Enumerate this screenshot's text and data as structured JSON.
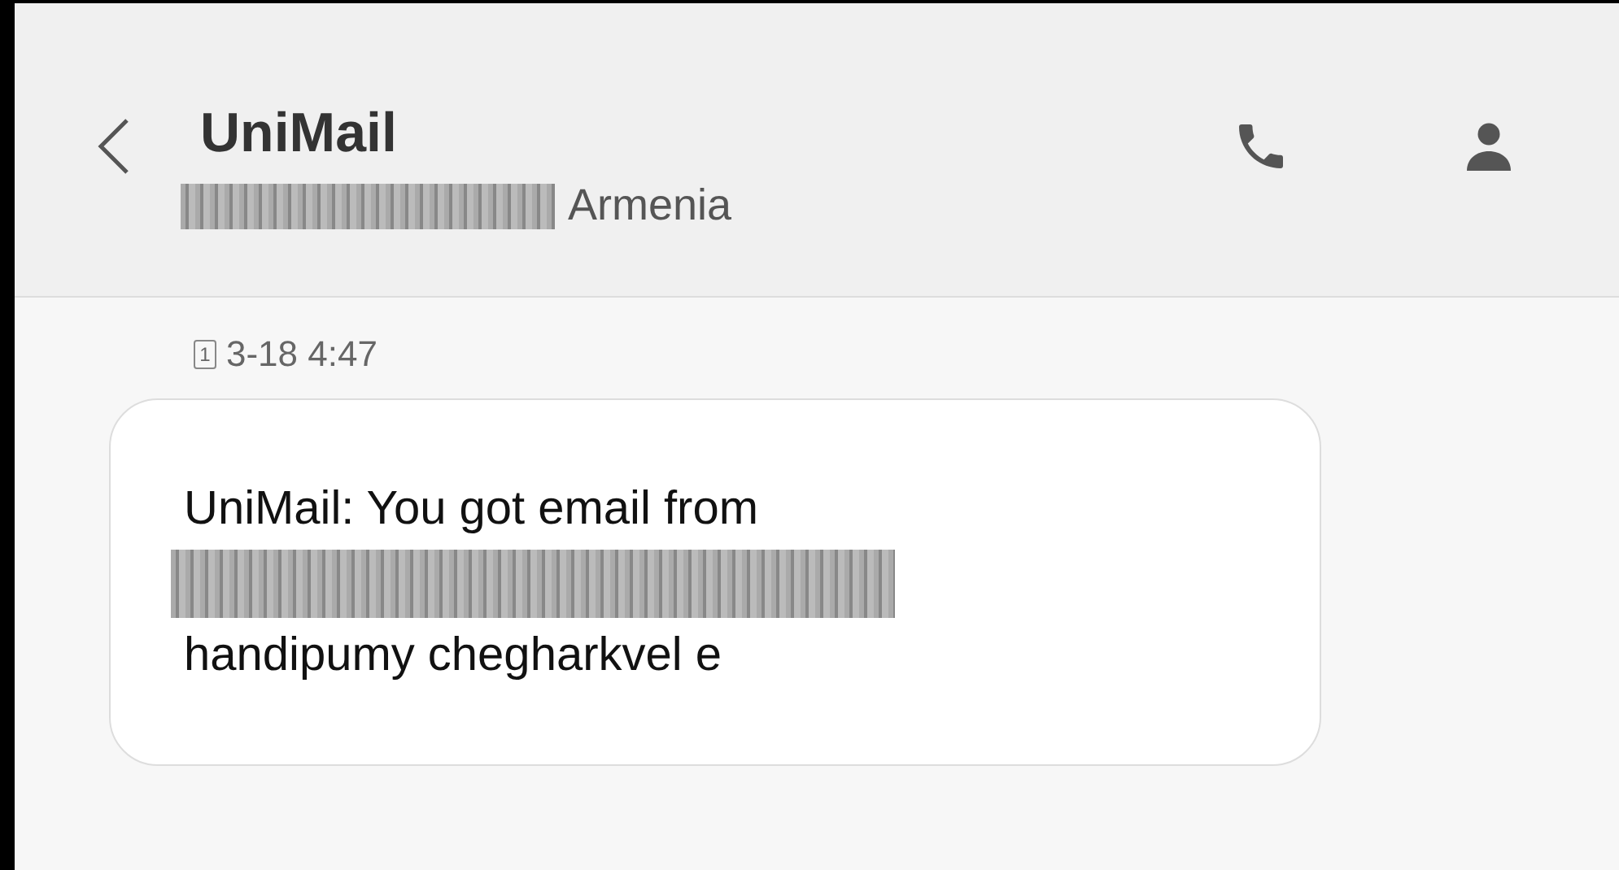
{
  "header": {
    "title": "UniMail",
    "subtitle": "Armenia",
    "subtitle_redacted": true
  },
  "messages": [
    {
      "sim_slot": "1",
      "time": "3-18 4:47",
      "lines": [
        {
          "kind": "text",
          "text": "UniMail: You got email from"
        },
        {
          "kind": "redacted"
        },
        {
          "kind": "text",
          "text": "handipumy chegharkvel e"
        }
      ]
    }
  ]
}
